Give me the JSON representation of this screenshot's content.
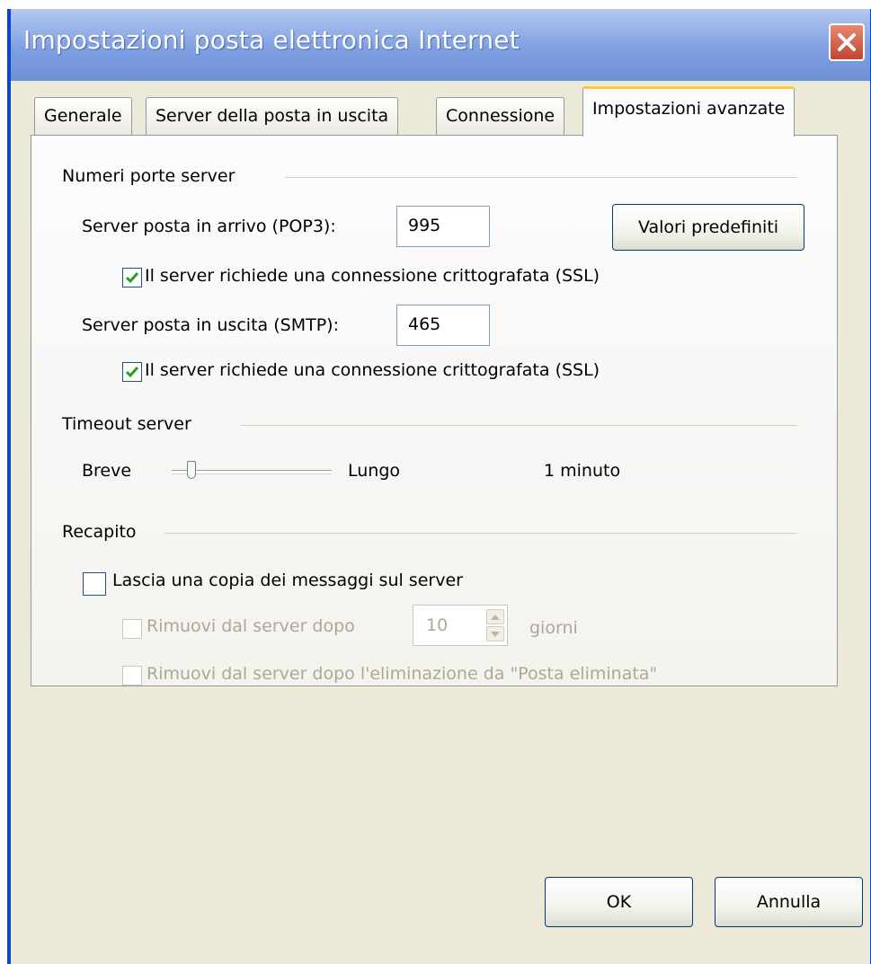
{
  "window": {
    "title": "Impostazioni posta elettronica Internet"
  },
  "tabs": [
    {
      "label": "Generale"
    },
    {
      "label": "Server della posta in uscita"
    },
    {
      "label": "Connessione"
    },
    {
      "label": "Impostazioni avanzate",
      "active": true
    }
  ],
  "ports": {
    "group_label": "Numeri porte server",
    "incoming_label": "Server posta in arrivo (POP3):",
    "incoming_value": "995",
    "defaults_button": "Valori predefiniti",
    "incoming_ssl_label": "Il server richiede una connessione crittografata (SSL)",
    "incoming_ssl_checked": true,
    "outgoing_label": "Server posta in uscita (SMTP):",
    "outgoing_value": "465",
    "outgoing_ssl_label": "Il server richiede una connessione crittografata (SSL)",
    "outgoing_ssl_checked": true
  },
  "timeout": {
    "group_label": "Timeout server",
    "short_label": "Breve",
    "long_label": "Lungo",
    "value_text": "1 minuto",
    "slider_level": 0.1
  },
  "delivery": {
    "group_label": "Recapito",
    "leave_copy_label": "Lascia una copia dei messaggi sul server",
    "leave_copy_checked": false,
    "remove_after_label": "Rimuovi dal server dopo",
    "remove_after_value": "10",
    "days_label": "giorni",
    "remove_deleted_label": "Rimuovi dal server dopo l'eliminazione da \"Posta eliminata\""
  },
  "buttons": {
    "ok": "OK",
    "cancel": "Annulla"
  },
  "colors": {
    "check_mark": "#21a121",
    "title_bar": "#7e9fe0",
    "active_tab_accent": "#ffc83c"
  }
}
